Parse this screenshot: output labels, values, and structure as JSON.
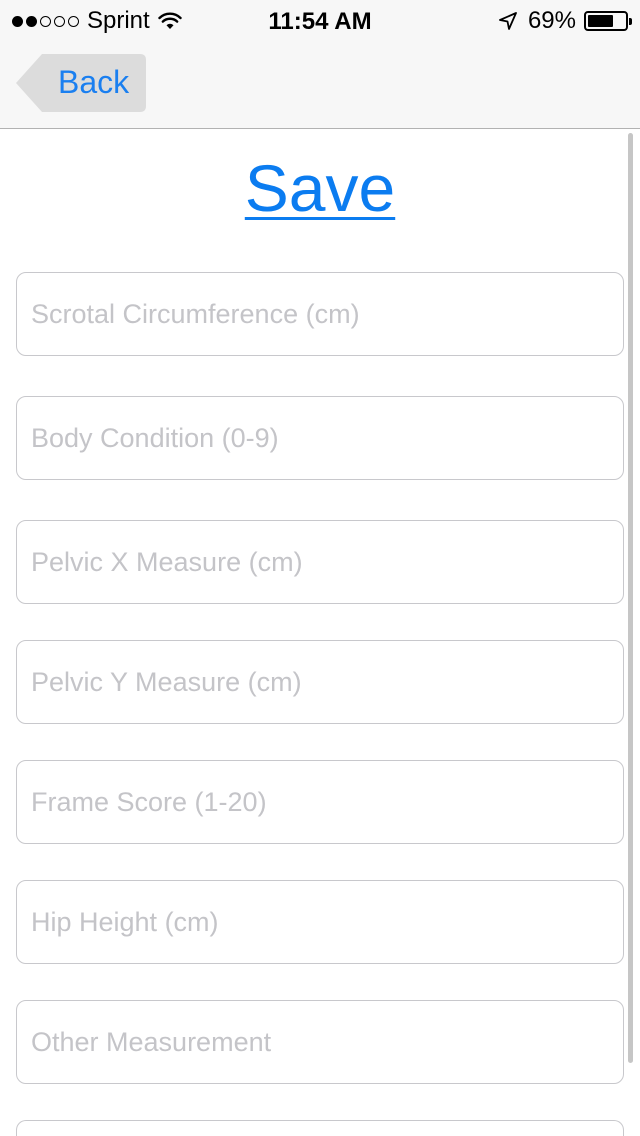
{
  "status_bar": {
    "carrier": "Sprint",
    "time": "11:54 AM",
    "battery": "69%",
    "signal_icon": "signal-dots-icon",
    "wifi_icon": "wifi-icon",
    "location_icon": "location-arrow-icon",
    "battery_icon": "battery-icon",
    "battery_level": 0.69
  },
  "nav": {
    "back_label": "Back"
  },
  "main": {
    "save_label": "Save",
    "fields": [
      {
        "placeholder": "Scrotal Circumference (cm)",
        "value": ""
      },
      {
        "placeholder": "Body Condition (0-9)",
        "value": ""
      },
      {
        "placeholder": "Pelvic X Measure (cm)",
        "value": ""
      },
      {
        "placeholder": "Pelvic Y Measure (cm)",
        "value": ""
      },
      {
        "placeholder": "Frame Score (1-20)",
        "value": ""
      },
      {
        "placeholder": "Hip Height (cm)",
        "value": ""
      },
      {
        "placeholder": "Other Measurement",
        "value": ""
      },
      {
        "placeholder": "",
        "value": ""
      }
    ]
  },
  "colors": {
    "accent": "#0b7cf0",
    "bar_background": "#f7f7f7",
    "field_border": "#c8c8cc",
    "placeholder": "#c4c4c8"
  }
}
